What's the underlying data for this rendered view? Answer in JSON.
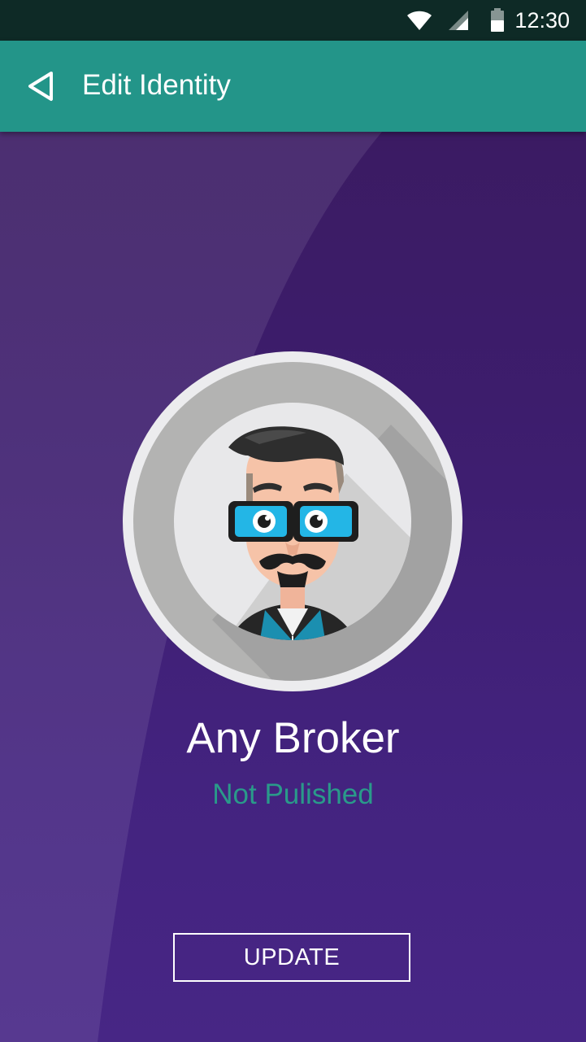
{
  "status_bar": {
    "time": "12:30",
    "icons": [
      "wifi-icon",
      "cell-signal-icon",
      "battery-icon"
    ]
  },
  "app_bar": {
    "back_icon": "back-triangle-icon",
    "title": "Edit Identity"
  },
  "profile": {
    "avatar": "cartoon-man-avatar",
    "name": "Any Broker",
    "status": "Not Pulished"
  },
  "actions": {
    "update_label": "UPDATE"
  },
  "colors": {
    "app_bar": "#239589",
    "status_bar": "#0e2a26",
    "background_top": "#3a1a5e",
    "background_bottom": "#472685",
    "status_text": "#2a9a8a"
  }
}
